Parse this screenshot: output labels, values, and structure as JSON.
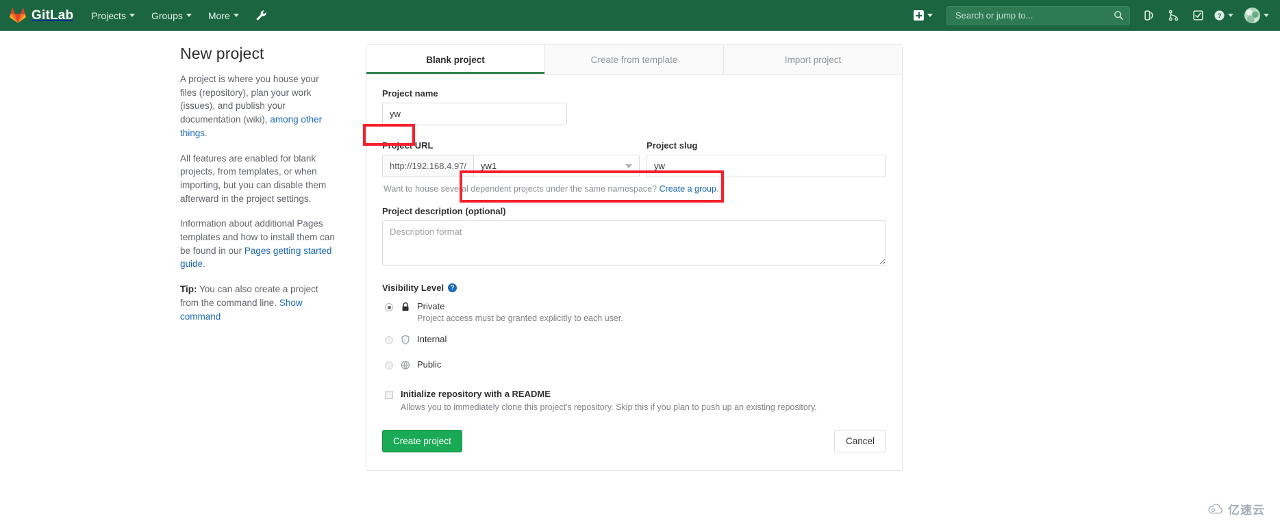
{
  "navbar": {
    "brand": "GitLab",
    "brand_logo_icon": "gitlab-tanuki-icon",
    "items": [
      {
        "label": "Projects",
        "icon": "chevron-down-icon"
      },
      {
        "label": "Groups",
        "icon": "chevron-down-icon"
      },
      {
        "label": "More",
        "icon": "chevron-down-icon"
      }
    ],
    "wrench_icon": "wrench-icon",
    "create_new_icon": "plus-square-icon",
    "search": {
      "placeholder": "Search or jump to...",
      "value": "",
      "icon": "search-icon"
    },
    "issues_icon": "issues-icon",
    "merge_requests_icon": "merge-request-icon",
    "todos_icon": "todo-checkbox-icon",
    "help_icon": "question-circle-icon",
    "avatar_icon": "user-avatar-icon"
  },
  "aside": {
    "title": "New project",
    "p1_a": "A project is where you house your files (repository), plan your work (issues), and publish your documentation (wiki), ",
    "p1_link": "among other things",
    "p1_b": ".",
    "p2": "All features are enabled for blank projects, from templates, or when importing, but you can disable them afterward in the project settings.",
    "p3_a": "Information about additional Pages templates and how to install them can be found in our ",
    "p3_link": "Pages getting started guide",
    "p3_b": ".",
    "tip_label": "Tip:",
    "tip_text": " You can also create a project from the command line. ",
    "tip_link": "Show command"
  },
  "tabs": [
    {
      "label": "Blank project",
      "active": true
    },
    {
      "label": "Create from template",
      "active": false
    },
    {
      "label": "Import project",
      "active": false
    }
  ],
  "form": {
    "project_name_label": "Project name",
    "project_name_value": "yw",
    "project_url_label": "Project URL",
    "url_prefix": "http://192.168.4.97/",
    "namespace_value": "yw1",
    "project_slug_label": "Project slug",
    "project_slug_value": "yw",
    "namespace_hint_text": "Want to house several dependent projects under the same namespace? ",
    "namespace_hint_link": "Create a group",
    "namespace_hint_end": ".",
    "description_label": "Project description (optional)",
    "description_placeholder": "Description format",
    "description_value": "",
    "visibility_label": "Visibility Level",
    "visibility_help_icon": "question-mark-icon",
    "visibility_options": [
      {
        "name": "Private",
        "icon": "lock-icon",
        "description": "Project access must be granted explicitly to each user.",
        "selected": true,
        "disabled": false
      },
      {
        "name": "Internal",
        "icon": "shield-icon",
        "description": "",
        "selected": false,
        "disabled": true
      },
      {
        "name": "Public",
        "icon": "globe-icon",
        "description": "",
        "selected": false,
        "disabled": true
      }
    ],
    "readme_label": "Initialize repository with a README",
    "readme_sub": "Allows you to immediately clone this project's repository. Skip this if you plan to push up an existing repository.",
    "readme_checked": false,
    "create_button": "Create project",
    "cancel_button": "Cancel"
  },
  "watermark": {
    "text": "亿速云",
    "icon": "cloud-icon"
  },
  "colors": {
    "navbar_green": "#1b6640",
    "accent_green": "#1aaa55",
    "tab_underline": "#31834f",
    "link_blue": "#1b69b6",
    "annotation_red": "#f5222d"
  }
}
